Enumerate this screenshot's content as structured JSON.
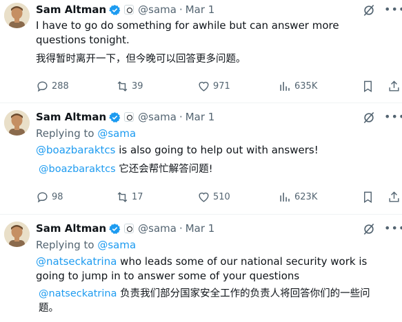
{
  "tweets": [
    {
      "name": "Sam Altman",
      "handle": "@sama",
      "dot": "·",
      "date": "Mar 1",
      "replying_prefix": "",
      "replying_handle": "",
      "mention": "",
      "text": "I have to go do something for awhile but can answer more questions tonight.",
      "translation_mention": "",
      "translation": "我得暂时离开一下，但今晚可以回答更多问题。",
      "stats": {
        "replies": "288",
        "reposts": "39",
        "likes": "971",
        "views": "635K"
      }
    },
    {
      "name": "Sam Altman",
      "handle": "@sama",
      "dot": "·",
      "date": "Mar 1",
      "replying_prefix": "Replying to ",
      "replying_handle": "@sama",
      "mention": "@boazbaraktcs",
      "text": " is also going to help out with answers!",
      "translation_mention": "@boazbaraktcs",
      "translation": " 它还会帮忙解答问题!",
      "stats": {
        "replies": "98",
        "reposts": "17",
        "likes": "510",
        "views": "623K"
      }
    },
    {
      "name": "Sam Altman",
      "handle": "@sama",
      "dot": "·",
      "date": "Mar 1",
      "replying_prefix": "Replying to ",
      "replying_handle": "@sama",
      "mention": "@natseckatrina",
      "text": " who leads some of our national security work is going to jump in to answer some of your questions",
      "translation_mention": "@natseckatrina",
      "translation": " 负责我们部分国家安全工作的负责人将回答你们的一些问题。",
      "stats": {}
    }
  ],
  "icons": {
    "verified": "verified-badge-icon",
    "affiliation": "affiliate-badge-icon",
    "grok": "grok-icon",
    "more": "more-icon",
    "reply": "reply-icon",
    "repost": "repost-icon",
    "like": "like-icon",
    "views": "views-icon",
    "bookmark": "bookmark-icon",
    "share": "share-icon"
  },
  "colors": {
    "link": "#1d9bf0",
    "muted": "#536471",
    "text": "#0f1419",
    "verified": "#1d9bf0"
  }
}
